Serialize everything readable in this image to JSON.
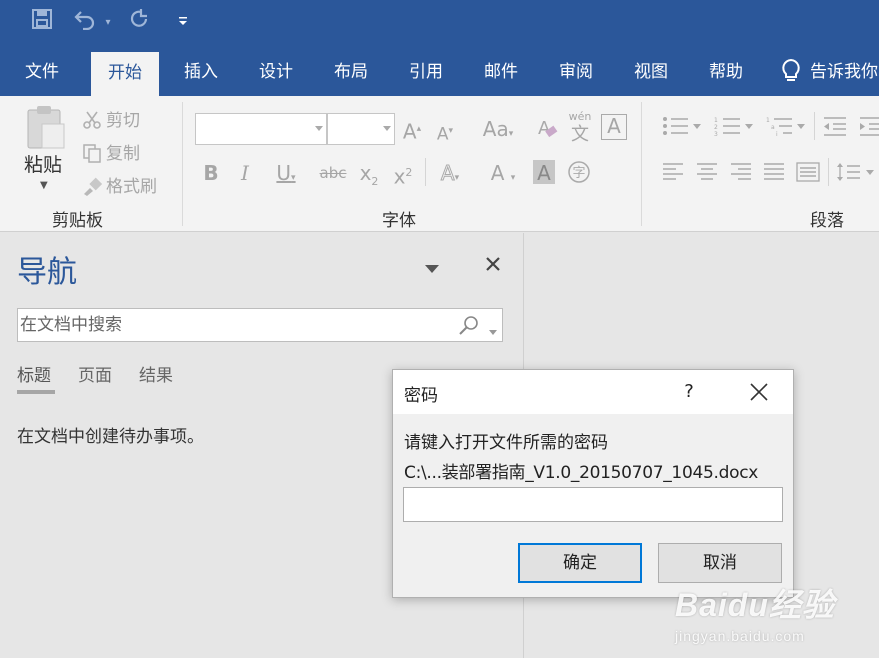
{
  "quick_access": {
    "save_icon": "save-icon",
    "undo_icon": "undo-icon",
    "redo_icon": "redo-icon",
    "customize_icon": "customize-qat-icon"
  },
  "ribbon_tabs": [
    "文件",
    "开始",
    "插入",
    "设计",
    "布局",
    "引用",
    "邮件",
    "审阅",
    "视图",
    "帮助"
  ],
  "active_tab": "开始",
  "tell_me": "告诉我你",
  "clipboard": {
    "paste": "粘贴",
    "cut": "剪切",
    "copy": "复制",
    "format_painter": "格式刷",
    "group_label": "剪贴板"
  },
  "font_group": {
    "grow": "A",
    "shrink": "A",
    "change_case": "Aa",
    "phonetic": "wén",
    "phonetic_char": "文",
    "bold": "B",
    "italic": "I",
    "underline": "U",
    "strikethrough": "abc",
    "subscript": "x",
    "subscript_mark": "2",
    "superscript": "x",
    "superscript_mark": "2",
    "font_color": "A",
    "enclose": "字",
    "group_label": "字体"
  },
  "paragraph_group": {
    "group_label": "段落"
  },
  "nav_pane": {
    "title": "导航",
    "search_placeholder": "在文档中搜索",
    "tabs": [
      "标题",
      "页面",
      "结果"
    ],
    "message": "在文档中创建待办事项。"
  },
  "password_dialog": {
    "title": "密码",
    "help": "?",
    "prompt": "请键入打开文件所需的密码",
    "file_path": "C:\\...装部署指南_V1.0_20150707_1045.docx",
    "ok": "确定",
    "cancel": "取消"
  },
  "watermark": {
    "brand": "Baidu经验",
    "url": "jingyan.baidu.com"
  },
  "colors": {
    "brand_blue": "#2b579a",
    "ribbon_bg": "#f3f3f3",
    "pane_bg": "#e6e6e6",
    "focus_blue": "#0078d7"
  }
}
